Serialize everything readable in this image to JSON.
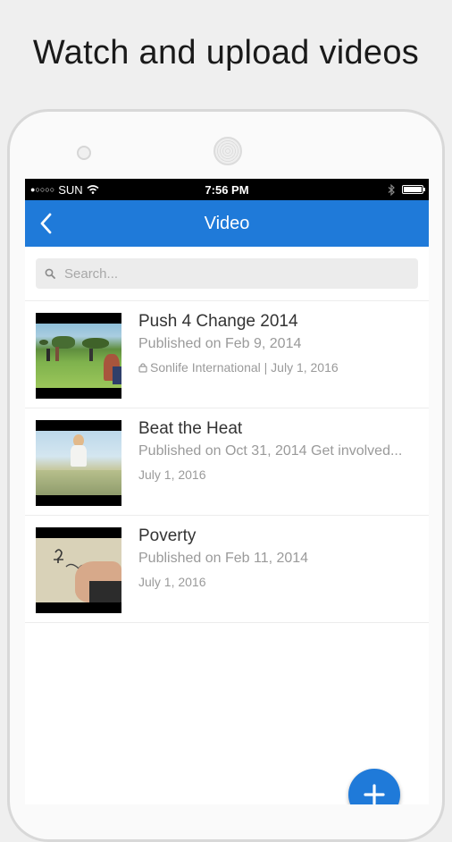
{
  "headline": "Watch and upload videos",
  "status_bar": {
    "carrier": "SUN",
    "time": "7:56 PM",
    "signal_dots": "●○○○○"
  },
  "nav": {
    "title": "Video",
    "back_icon": "chevron-left-icon"
  },
  "search": {
    "placeholder": "Search...",
    "value": ""
  },
  "videos": [
    {
      "title": "Push 4 Change 2014",
      "description": "Published on Feb 9, 2014",
      "meta": "Sonlife International | July 1, 2016",
      "locked": true
    },
    {
      "title": "Beat the Heat",
      "description": "Published on Oct 31, 2014 Get involved...",
      "meta": "July 1, 2016",
      "locked": false
    },
    {
      "title": "Poverty",
      "description": "Published on Feb 11, 2014",
      "meta": "July 1, 2016",
      "locked": false
    }
  ],
  "fab": {
    "icon": "plus-icon"
  },
  "colors": {
    "accent": "#1f7ad9",
    "background": "#efefef"
  }
}
